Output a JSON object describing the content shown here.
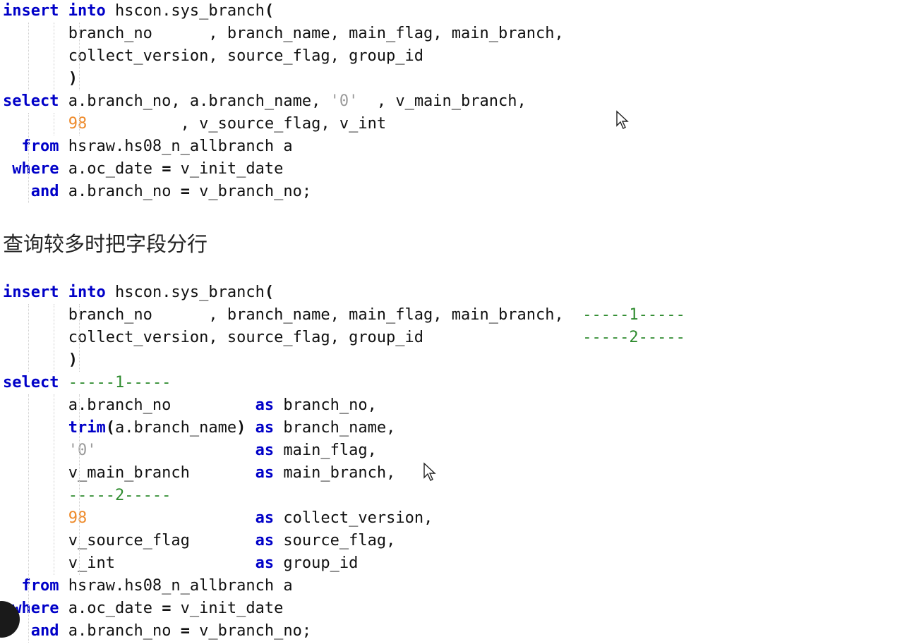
{
  "block1": {
    "lines": [
      [
        [
          "kw",
          "insert"
        ],
        [
          "t",
          " "
        ],
        [
          "kw",
          "into"
        ],
        [
          "t",
          " hscon.sys_branch"
        ],
        [
          "op",
          "("
        ]
      ],
      [
        [
          "t",
          "       branch_no      , branch_name, main_flag, main_branch,"
        ]
      ],
      [
        [
          "t",
          "       collect_version, source_flag, group_id"
        ]
      ],
      [
        [
          "t",
          "       "
        ],
        [
          "op",
          ")"
        ]
      ],
      [
        [
          "kw",
          "select"
        ],
        [
          "t",
          " a.branch_no, a.branch_name, "
        ],
        [
          "str",
          "'0'"
        ],
        [
          "t",
          "  , v_main_branch,"
        ]
      ],
      [
        [
          "t",
          "       "
        ],
        [
          "num",
          "98"
        ],
        [
          "t",
          "          , v_source_flag, v_int"
        ]
      ],
      [
        [
          "t",
          "  "
        ],
        [
          "kw",
          "from"
        ],
        [
          "t",
          " hsraw.hs08_n_allbranch a"
        ]
      ],
      [
        [
          "t",
          " "
        ],
        [
          "kw",
          "where"
        ],
        [
          "t",
          " a.oc_date "
        ],
        [
          "op",
          "="
        ],
        [
          "t",
          " v_init_date"
        ]
      ],
      [
        [
          "t",
          "   "
        ],
        [
          "kw",
          "and"
        ],
        [
          "t",
          " a.branch_no "
        ],
        [
          "op",
          "="
        ],
        [
          "t",
          " v_branch_no;"
        ]
      ]
    ]
  },
  "heading": "查询较多时把字段分行",
  "block2": {
    "lines": [
      [
        [
          "kw",
          "insert"
        ],
        [
          "t",
          " "
        ],
        [
          "kw",
          "into"
        ],
        [
          "t",
          " hscon.sys_branch"
        ],
        [
          "op",
          "("
        ]
      ],
      [
        [
          "t",
          "       branch_no      , branch_name, main_flag, main_branch,  "
        ],
        [
          "cmt",
          "-----1-----"
        ]
      ],
      [
        [
          "t",
          "       collect_version, source_flag, group_id                 "
        ],
        [
          "cmt",
          "-----2-----"
        ]
      ],
      [
        [
          "t",
          "       "
        ],
        [
          "op",
          ")"
        ]
      ],
      [
        [
          "kw",
          "select"
        ],
        [
          "t",
          " "
        ],
        [
          "cmt",
          "-----1-----"
        ]
      ],
      [
        [
          "t",
          "       a.branch_no         "
        ],
        [
          "kw",
          "as"
        ],
        [
          "t",
          " branch_no,"
        ]
      ],
      [
        [
          "t",
          "       "
        ],
        [
          "kw",
          "trim"
        ],
        [
          "op",
          "("
        ],
        [
          "t",
          "a.branch_name"
        ],
        [
          "op",
          ")"
        ],
        [
          "t",
          " "
        ],
        [
          "kw",
          "as"
        ],
        [
          "t",
          " branch_name,"
        ]
      ],
      [
        [
          "t",
          "       "
        ],
        [
          "str",
          "'0'"
        ],
        [
          "t",
          "                 "
        ],
        [
          "kw",
          "as"
        ],
        [
          "t",
          " main_flag,"
        ]
      ],
      [
        [
          "t",
          "       v_main_branch       "
        ],
        [
          "kw",
          "as"
        ],
        [
          "t",
          " main_branch,"
        ]
      ],
      [
        [
          "t",
          "       "
        ],
        [
          "cmt",
          "-----2-----"
        ]
      ],
      [
        [
          "t",
          "       "
        ],
        [
          "num",
          "98"
        ],
        [
          "t",
          "                  "
        ],
        [
          "kw",
          "as"
        ],
        [
          "t",
          " collect_version,"
        ]
      ],
      [
        [
          "t",
          "       v_source_flag       "
        ],
        [
          "kw",
          "as"
        ],
        [
          "t",
          " source_flag,"
        ]
      ],
      [
        [
          "t",
          "       v_int               "
        ],
        [
          "kw",
          "as"
        ],
        [
          "t",
          " group_id"
        ]
      ],
      [
        [
          "t",
          "  "
        ],
        [
          "kw",
          "from"
        ],
        [
          "t",
          " hsraw.hs08_n_allbranch a"
        ]
      ],
      [
        [
          "t",
          " "
        ],
        [
          "kw",
          "where"
        ],
        [
          "t",
          " a.oc_date "
        ],
        [
          "op",
          "="
        ],
        [
          "t",
          " v_init_date"
        ]
      ],
      [
        [
          "t",
          "   "
        ],
        [
          "kw",
          "and"
        ],
        [
          "t",
          " a.branch_no "
        ],
        [
          "op",
          "="
        ],
        [
          "t",
          " v_branch_no;"
        ]
      ]
    ]
  },
  "colors": {
    "keyword": "#0000c8",
    "string": "#9a9a9a",
    "number": "#ee8a2a",
    "comment": "#2e8b2e",
    "text": "#111111"
  },
  "icons": {
    "cursor": "mouse-pointer-icon"
  }
}
